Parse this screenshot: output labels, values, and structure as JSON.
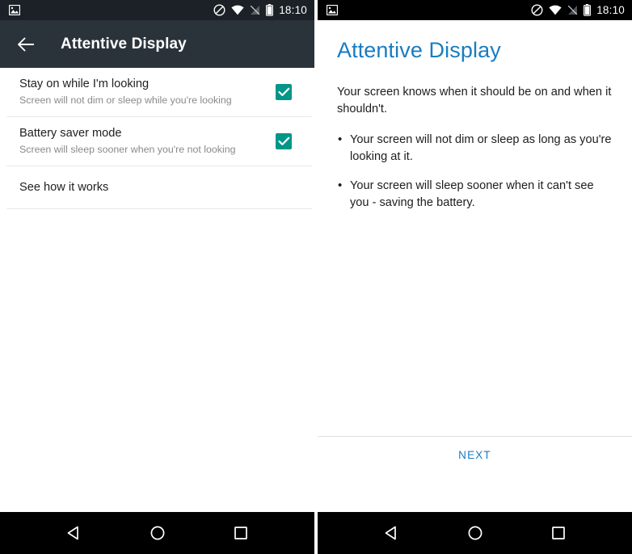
{
  "left_screen": {
    "statusbar": {
      "time": "18:10",
      "icons": [
        "image-icon",
        "do-not-disturb-icon",
        "wifi-icon",
        "signal-off-icon",
        "battery-icon"
      ]
    },
    "toolbar": {
      "back_icon": "back-arrow-icon",
      "title": "Attentive Display"
    },
    "settings": [
      {
        "primary": "Stay on while I'm looking",
        "secondary": "Screen will not dim or sleep while you're looking",
        "checked": true
      },
      {
        "primary": "Battery saver mode",
        "secondary": "Screen will sleep sooner when you're not looking",
        "checked": true
      },
      {
        "primary": "See how it works",
        "secondary": "",
        "checked": null
      }
    ],
    "navbar": {
      "back": "nav-back-triangle-icon",
      "home": "nav-home-circle-icon",
      "recents": "nav-recents-square-icon"
    }
  },
  "right_screen": {
    "statusbar": {
      "time": "18:10",
      "icons": [
        "image-icon",
        "do-not-disturb-icon",
        "wifi-icon",
        "signal-off-icon",
        "battery-icon"
      ]
    },
    "title": "Attentive Display",
    "intro": "Your screen knows when it should be on and when it shouldn't.",
    "bullets": [
      "Your screen will not dim or sleep as long as you're looking at it.",
      "Your screen will sleep sooner when it can't see you - saving the battery."
    ],
    "next_label": "NEXT",
    "navbar": {
      "back": "nav-back-triangle-icon",
      "home": "nav-home-circle-icon",
      "recents": "nav-recents-square-icon"
    }
  },
  "colors": {
    "toolbar": "#2b333a",
    "statusbar_left": "#1b2126",
    "statusbar_right": "#000000",
    "accent_checkbox": "#009688",
    "accent_blue": "#1a7cc1",
    "navbar": "#000000"
  }
}
